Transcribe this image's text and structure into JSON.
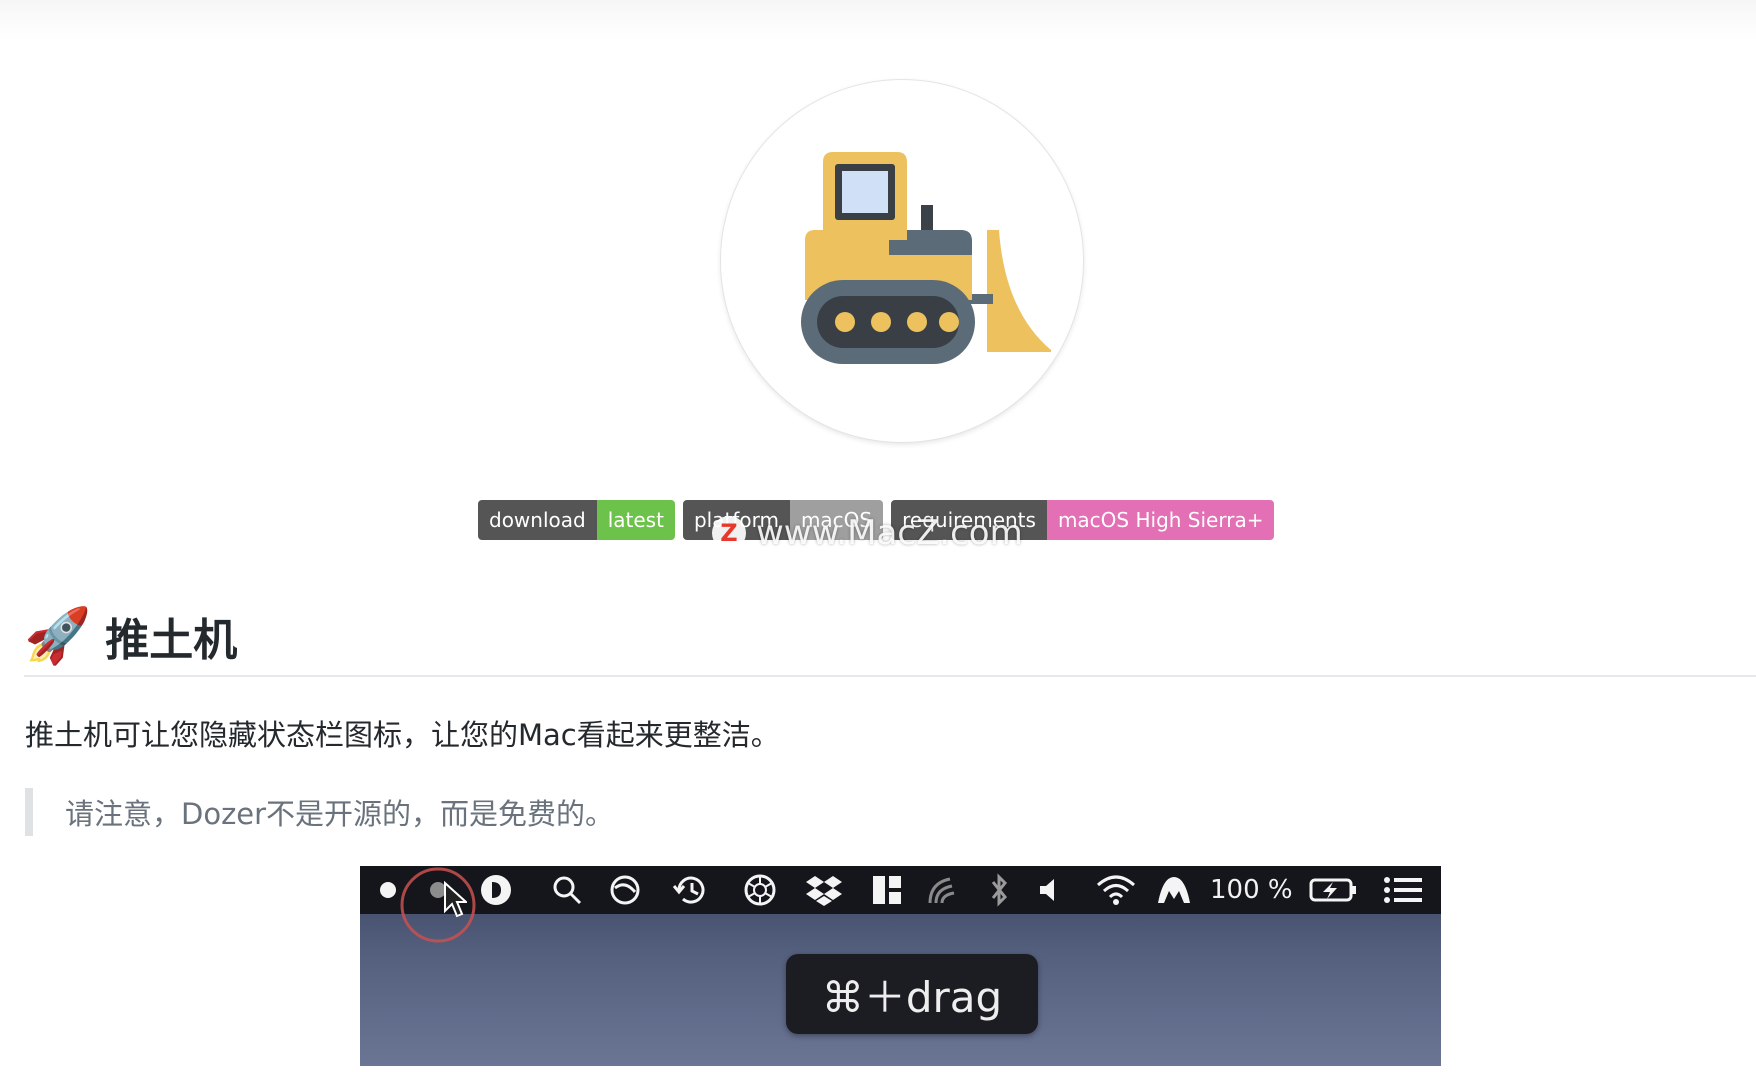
{
  "badges": [
    {
      "key": "download",
      "value": "latest",
      "color": "#6cc24a"
    },
    {
      "key": "platform",
      "value": "macOS",
      "color": "#9f9f9f"
    },
    {
      "key": "requirements",
      "value": "macOS High Sierra+",
      "color": "#e36fb5"
    }
  ],
  "watermark": {
    "logo_letter": "Z",
    "text": "www.MacZ.com"
  },
  "heading": {
    "emoji": "🚀",
    "title": "推土机"
  },
  "intro": "推土机可让您隐藏状态栏图标，让您的Mac看起来更整洁。",
  "note": "请注意，Dozer不是开源的，而是免费的。",
  "screenshot": {
    "menubar_icons": [
      "dot-icon",
      "hidden-dot-icon",
      "cursor-icon",
      "dozer-icon",
      "search-icon",
      "focus-icon",
      "time-machine-icon",
      "aperture-icon",
      "dropbox-icon",
      "layout-icon",
      "airplay-icon",
      "bluetooth-icon",
      "volume-icon",
      "wifi-icon",
      "vpn-icon",
      "battery-icon",
      "list-icon"
    ],
    "battery_text": "100 %",
    "hint": "⌘＋drag"
  },
  "colors": {
    "link_green": "#6cc24a",
    "badge_dark": "#555555",
    "badge_pink": "#e36fb5",
    "bulldozer_yellow": "#edc25e",
    "bulldozer_gray": "#5c6b78"
  }
}
